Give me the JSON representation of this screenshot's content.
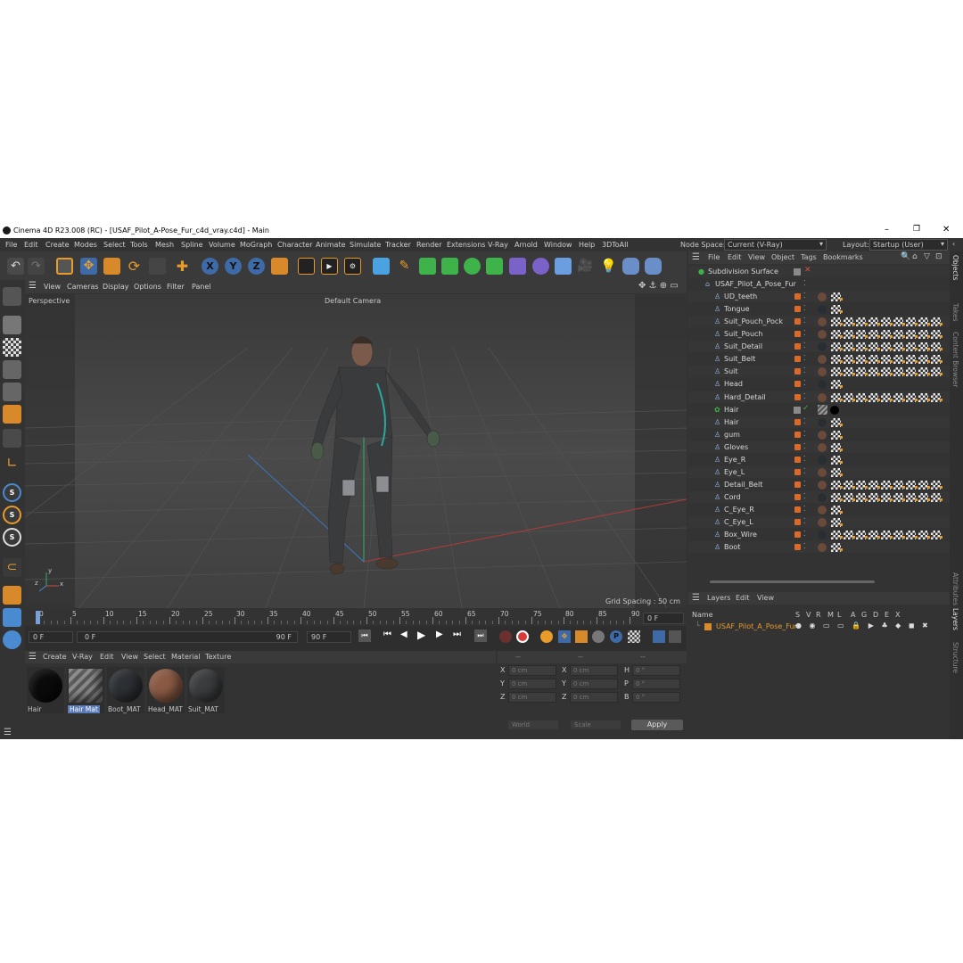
{
  "window": {
    "title": "Cinema 4D R23.008 (RC) - [USAF_Pilot_A-Pose_Fur_c4d_vray.c4d] - Main",
    "controls": [
      "–",
      "❐",
      "✕"
    ]
  },
  "menu": {
    "items": [
      "File",
      "Edit",
      "Create",
      "Modes",
      "Select",
      "Tools",
      "Mesh",
      "Spline",
      "Volume",
      "MoGraph",
      "Character",
      "Animate",
      "Simulate",
      "Tracker",
      "Render",
      "Extensions",
      "V-Ray",
      "Arnold",
      "Window",
      "Help",
      "3DToAll"
    ],
    "node_space_label": "Node Space:",
    "node_space_value": "Current (V-Ray)",
    "layout_label": "Layout:",
    "layout_value": "Startup (User)"
  },
  "toolbar": {
    "axis_labels": [
      "X",
      "Y",
      "Z"
    ]
  },
  "viewport": {
    "menu": [
      "View",
      "Cameras",
      "Display",
      "Options",
      "Filter",
      "Panel"
    ],
    "view_name": "Perspective",
    "camera": "Default Camera",
    "grid_spacing": "Grid Spacing : 50 cm",
    "axis_labels": {
      "y": "y",
      "z": "z",
      "x": "x"
    }
  },
  "timeline": {
    "ticks": [
      "0",
      "5",
      "10",
      "15",
      "20",
      "25",
      "30",
      "35",
      "40",
      "45",
      "50",
      "55",
      "60",
      "65",
      "70",
      "75",
      "80",
      "85",
      "90"
    ],
    "current_frame": "0 F",
    "start": "0 F",
    "range_start": "0 F",
    "range_end": "90 F",
    "end": "90 F"
  },
  "material_manager": {
    "menu": [
      "Create",
      "V-Ray",
      "Edit",
      "View",
      "Select",
      "Material",
      "Texture"
    ],
    "materials": [
      {
        "name": "Hair",
        "color": "#0a0a0a"
      },
      {
        "name": "Hair Mat",
        "color": "#777777"
      },
      {
        "name": "Boot_MAT",
        "color": "#2c2f33"
      },
      {
        "name": "Head_MAT",
        "color": "#8a5a44"
      },
      {
        "name": "Suit_MAT",
        "color": "#3a3c3e"
      }
    ]
  },
  "coordinates": {
    "header": [
      "--",
      "--",
      "--"
    ],
    "rows": [
      {
        "a": "X",
        "av": "0 cm",
        "b": "X",
        "bv": "0 cm",
        "c": "H",
        "cv": "0 °"
      },
      {
        "a": "Y",
        "av": "0 cm",
        "b": "Y",
        "bv": "0 cm",
        "c": "P",
        "cv": "0 °"
      },
      {
        "a": "Z",
        "av": "0 cm",
        "b": "Z",
        "bv": "0 cm",
        "c": "B",
        "cv": "0 °"
      }
    ],
    "space": "World",
    "mode": "Scale",
    "apply": "Apply"
  },
  "object_manager": {
    "menu": [
      "File",
      "Edit",
      "View",
      "Object",
      "Tags",
      "Bookmarks"
    ],
    "objects": [
      {
        "name": "Subdivision Surface",
        "level": 0,
        "tags": 0
      },
      {
        "name": "USAF_Pilot_A_Pose_Fur",
        "level": 1,
        "tags": 0
      },
      {
        "name": "UD_teeth",
        "level": 2,
        "tags": 1
      },
      {
        "name": "Tongue",
        "level": 2,
        "tags": 1
      },
      {
        "name": "Suit_Pouch_Pock",
        "level": 2,
        "tags": 9
      },
      {
        "name": "Suit_Pouch",
        "level": 2,
        "tags": 9
      },
      {
        "name": "Suit_Detail",
        "level": 2,
        "tags": 9
      },
      {
        "name": "Suit_Belt",
        "level": 2,
        "tags": 9
      },
      {
        "name": "Suit",
        "level": 2,
        "tags": 9
      },
      {
        "name": "Head",
        "level": 2,
        "tags": 1
      },
      {
        "name": "Hard_Detail",
        "level": 2,
        "tags": 9
      },
      {
        "name": "Hair",
        "level": 2,
        "tags": 0
      },
      {
        "name": "Hair",
        "level": 2,
        "tags": 1
      },
      {
        "name": "gum",
        "level": 2,
        "tags": 1
      },
      {
        "name": "Gloves",
        "level": 2,
        "tags": 1
      },
      {
        "name": "Eye_R",
        "level": 2,
        "tags": 1
      },
      {
        "name": "Eye_L",
        "level": 2,
        "tags": 1
      },
      {
        "name": "Detail_Belt",
        "level": 2,
        "tags": 9
      },
      {
        "name": "Cord",
        "level": 2,
        "tags": 9
      },
      {
        "name": "C_Eye_R",
        "level": 2,
        "tags": 1
      },
      {
        "name": "C_Eye_L",
        "level": 2,
        "tags": 1
      },
      {
        "name": "Box_Wire",
        "level": 2,
        "tags": 9
      },
      {
        "name": "Boot",
        "level": 2,
        "tags": 1
      }
    ]
  },
  "layers": {
    "menu": [
      "Layers",
      "Edit",
      "View"
    ],
    "columns": [
      "Name",
      "S",
      "V",
      "R",
      "M",
      "L",
      "A",
      "G",
      "D",
      "E",
      "X"
    ],
    "rows": [
      {
        "name": "USAF_Pilot_A_Pose_Fur"
      }
    ]
  },
  "side_tabs": [
    "Objects",
    "Takes",
    "Content Browser",
    "Attributes",
    "Layers",
    "Structure"
  ]
}
